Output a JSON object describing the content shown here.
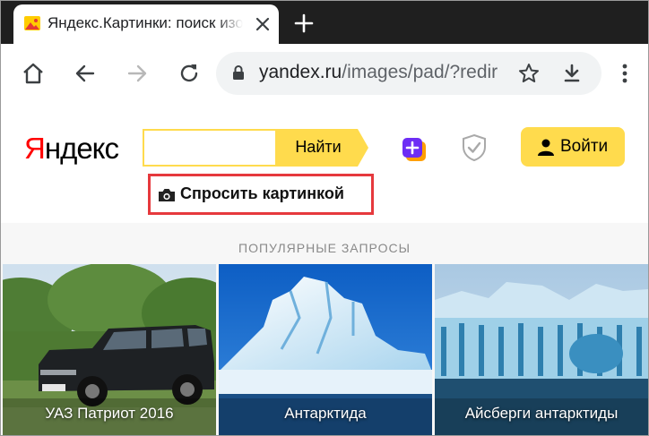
{
  "browser": {
    "tab_title": "Яндекс.Картинки: поиск изображений в интернете",
    "url_host": "yandex.ru",
    "url_path": "/images/pad/?redir"
  },
  "header": {
    "logo_first": "Я",
    "logo_rest": "ндекс",
    "search_value": "",
    "search_button": "Найти",
    "login_button": "Войти",
    "ask_by_image": "Спросить картинкой"
  },
  "popular": {
    "title": "ПОПУЛЯРНЫЕ ЗАПРОСЫ",
    "items": [
      {
        "label": "УАЗ Патриот 2016"
      },
      {
        "label": "Антарктида"
      },
      {
        "label": "Айсберги антарктиды"
      }
    ]
  },
  "colors": {
    "accent_yellow": "#ffdb4d",
    "highlight_red": "#e6393d",
    "logo_red": "#ff0000"
  }
}
